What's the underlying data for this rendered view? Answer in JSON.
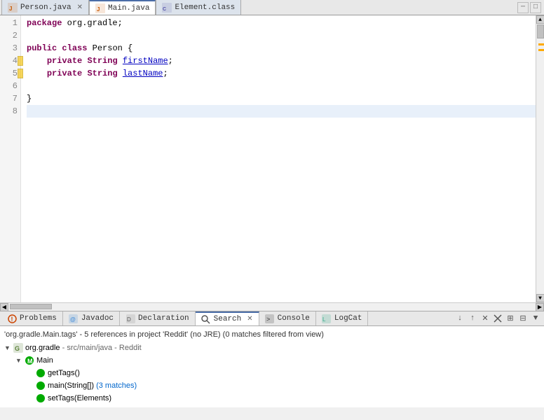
{
  "tabs": [
    {
      "id": "person-java",
      "label": "Person.java",
      "icon": "java-icon",
      "active": false,
      "closeable": true
    },
    {
      "id": "main-java",
      "label": "Main.java",
      "icon": "java-icon",
      "active": true,
      "closeable": false
    },
    {
      "id": "element-class",
      "label": "Element.class",
      "icon": "class-icon",
      "active": false,
      "closeable": false
    }
  ],
  "tab_controls": {
    "minimize": "▭",
    "maximize": "□",
    "close": "×"
  },
  "code": {
    "lines": [
      {
        "num": 1,
        "content": "package org.gradle;",
        "tokens": [
          {
            "t": "kw",
            "v": "package"
          },
          {
            "t": "plain",
            "v": " org.gradle;"
          }
        ]
      },
      {
        "num": 2,
        "content": "",
        "tokens": []
      },
      {
        "num": 3,
        "content": "public class Person {",
        "tokens": [
          {
            "t": "kw",
            "v": "public"
          },
          {
            "t": "plain",
            "v": " "
          },
          {
            "t": "kw",
            "v": "class"
          },
          {
            "t": "plain",
            "v": " Person {"
          }
        ]
      },
      {
        "num": 4,
        "content": "    private String firstName;",
        "tokens": [
          {
            "t": "plain",
            "v": "    "
          },
          {
            "t": "kw",
            "v": "private"
          },
          {
            "t": "plain",
            "v": " "
          },
          {
            "t": "type",
            "v": "String"
          },
          {
            "t": "plain",
            "v": " "
          },
          {
            "t": "link",
            "v": "firstName"
          },
          {
            "t": "plain",
            "v": ";"
          }
        ]
      },
      {
        "num": 5,
        "content": "    private String lastName;",
        "tokens": [
          {
            "t": "plain",
            "v": "    "
          },
          {
            "t": "kw",
            "v": "private"
          },
          {
            "t": "plain",
            "v": " "
          },
          {
            "t": "type",
            "v": "String"
          },
          {
            "t": "plain",
            "v": " "
          },
          {
            "t": "link",
            "v": "lastName"
          },
          {
            "t": "plain",
            "v": ";"
          }
        ]
      },
      {
        "num": 6,
        "content": "",
        "tokens": []
      },
      {
        "num": 7,
        "content": "}",
        "tokens": [
          {
            "t": "plain",
            "v": "}"
          }
        ]
      },
      {
        "num": 8,
        "content": "",
        "tokens": [],
        "highlighted": true
      }
    ]
  },
  "bottom_tabs": [
    {
      "id": "problems",
      "label": "Problems",
      "icon": "problems-icon",
      "active": false
    },
    {
      "id": "javadoc",
      "label": "Javadoc",
      "icon": "javadoc-icon",
      "active": false
    },
    {
      "id": "declaration",
      "label": "Declaration",
      "icon": "declaration-icon",
      "active": false
    },
    {
      "id": "search",
      "label": "Search",
      "icon": "search-icon",
      "active": true,
      "closeable": true
    },
    {
      "id": "console",
      "label": "Console",
      "icon": "console-icon",
      "active": false
    },
    {
      "id": "logcat",
      "label": "LogCat",
      "icon": "logcat-icon",
      "active": false
    }
  ],
  "search_results": {
    "summary": "'org.gradle.Main.tags' - 5 references in project 'Reddit' (no JRE) (0 matches filtered from view)",
    "tree": [
      {
        "id": "org-gradle",
        "label": "org.gradle",
        "path": "- src/main/java - Reddit",
        "indent": 1,
        "type": "package",
        "expanded": true,
        "children": [
          {
            "id": "main-class",
            "label": "Main",
            "indent": 2,
            "type": "class",
            "expanded": true,
            "children": [
              {
                "id": "getTags",
                "label": "getTags()",
                "indent": 3,
                "type": "method"
              },
              {
                "id": "mainStringArray",
                "label": "main(String[])",
                "matches": " (3 matches)",
                "indent": 3,
                "type": "method"
              },
              {
                "id": "setTags",
                "label": "setTags(Elements)",
                "indent": 3,
                "type": "method"
              }
            ]
          }
        ]
      }
    ]
  },
  "bottom_controls": {
    "sort_down": "↓",
    "sort_up": "↑",
    "remove": "✕",
    "remove_all": "✕✕",
    "expand": "⊞",
    "collapse": "⊟",
    "more": "▼"
  }
}
